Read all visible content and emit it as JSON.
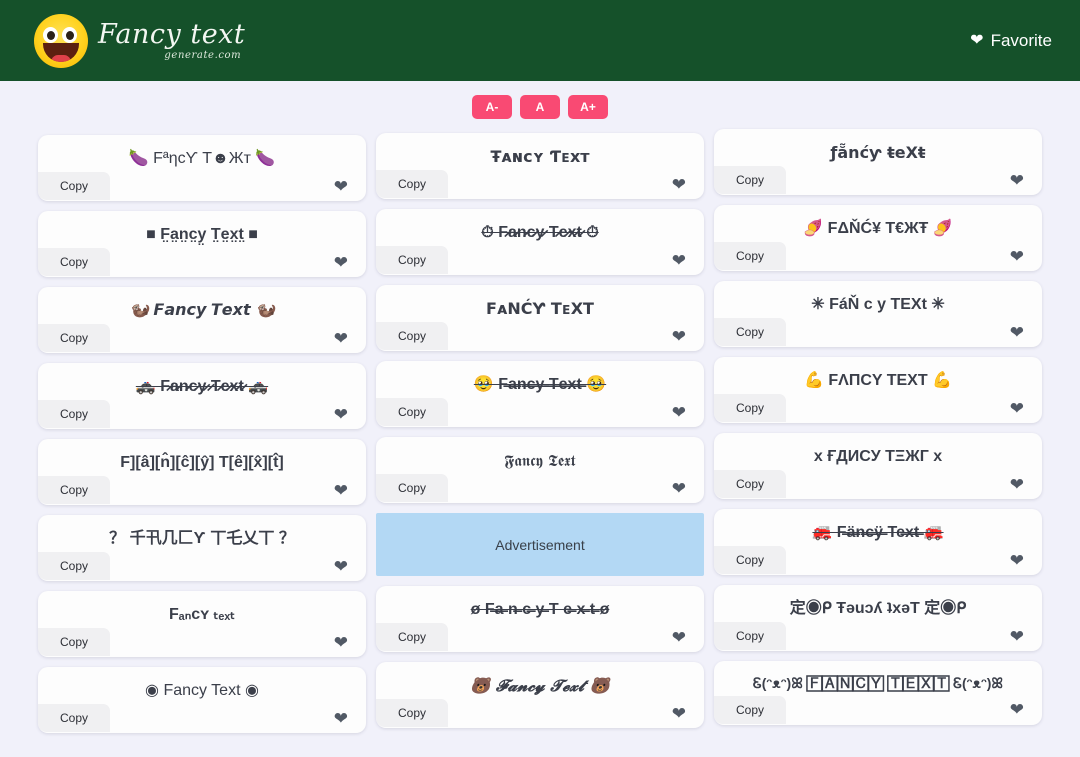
{
  "header": {
    "brand_title": "Fancy text",
    "brand_subtitle": "generate.com",
    "logo_icon": "smiley-face-logo",
    "favorite_label": "Favorite",
    "favorite_icon": "heart-icon",
    "background_color": "#15512a"
  },
  "size_controls": {
    "accent_color": "#f94a73",
    "buttons": [
      {
        "label": "A-",
        "name": "font-size-decrease-button"
      },
      {
        "label": "A",
        "name": "font-size-reset-button"
      },
      {
        "label": "A+",
        "name": "font-size-increase-button"
      }
    ]
  },
  "common": {
    "copy_label": "Copy",
    "favorite_icon": "heart-icon"
  },
  "advertisement": {
    "label": "Advertisement",
    "background_color": "#b3d8f4"
  },
  "columns": [
    {
      "cards": [
        {
          "text": "🍆 FªηcƳ T☻Жт 🍆",
          "style": "st-plain"
        },
        {
          "text": "■ F̤a̤n̤c̤y̤ T̤e̤x̤t̤ ■",
          "style": "st-bold"
        },
        {
          "text": "🦦 𝙁𝙖𝙣𝙘𝙮 𝙏𝙚𝙭𝙩 🦦",
          "style": "st-bolditalic"
        },
        {
          "text": "🚓 F̷a̷n̷c̷y̷ ̷T̷e̷x̷t̷ 🚓",
          "style": "st-bold st-strike"
        },
        {
          "text": "F][â][n̂][ĉ][ŷ] T[ê][x̂][t̂]",
          "style": "st-bold"
        },
        {
          "text": "？ 千卂几匚Ƴ 丅乇乂丅 ？",
          "style": "st-bold"
        },
        {
          "text": "Fₐₙᴄʏ ₜₑₓₜ",
          "style": "st-bold"
        },
        {
          "text": "◉ Fancy Text ◉",
          "style": "st-plain"
        }
      ]
    },
    {
      "cards": [
        {
          "text": "Ŧᴀɴcʏ Ƭᴇxᴛ",
          "style": "st-bold st-dejavu"
        },
        {
          "text": "⏱ F̷a̷n̷c̷y̷ T̷e̷x̷t̷ ⏱",
          "style": "st-bold st-strike"
        },
        {
          "text": "FᴀΝĆƳ TᴇXT",
          "style": "st-bold st-dejavu"
        },
        {
          "text": "🥹 F̶a̶n̶c̶y̶ ̶T̶e̶x̶t̶ 🥹",
          "style": "st-bold st-strike"
        },
        {
          "text": "𝕱𝖆𝖓𝖈𝖞 𝕿𝖊𝖝𝖙",
          "style": "st-serif"
        },
        {
          "text": "ø F̶a̶ n̶ c̶ y̶ T e̶ x̶ t̶ ø",
          "style": "st-bold st-strike"
        },
        {
          "text": "🐻 𝓕𝓪𝓷𝓬𝔂 𝓣𝓮𝔁𝓽 🐻",
          "style": "st-bolditalic st-serif"
        }
      ],
      "ad_after_index": 4
    },
    {
      "cards": [
        {
          "text": "ƒẵnćƴ ŧeXŧ",
          "style": "st-bold st-dejavu"
        },
        {
          "text": "🍠 FΔŇĆ¥ T€ЖŦ 🍠",
          "style": "st-bold"
        },
        {
          "text": "✳ FáŇ c y TEXt ✳",
          "style": "st-bold"
        },
        {
          "text": "💪 FΛПCY TEXT 💪",
          "style": "st-bold"
        },
        {
          "text": "x ҒДИCУ ТΞЖГ x",
          "style": "st-bold"
        },
        {
          "text": "🚒 F̶ä̶n̶c̶ÿ̶ Te̶x̶t̶ 🚒",
          "style": "st-bold st-strike"
        },
        {
          "text": "定◉ᑭ Ŧǝuɔʎ ʇxǝT 定◉ᑭ",
          "style": "st-bold"
        },
        {
          "text": "Ꮛ(ᵔᴥᵔ)ꕤ 🄵🄰🄽🄲🅈 🅃🄴🅇🅃 Ꮛ(ᵔᴥᵔ)ꕤ",
          "style": "st-bold st-small"
        }
      ]
    }
  ]
}
